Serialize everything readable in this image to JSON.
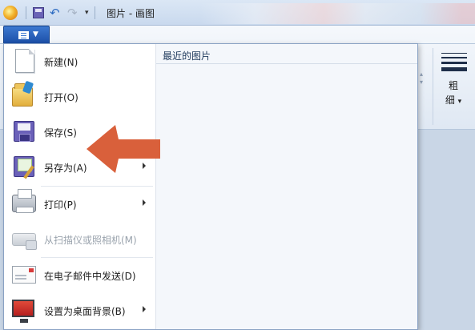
{
  "window": {
    "title": "图片 - 画图"
  },
  "quick_access": {
    "app_icon": "paint-app-icon",
    "save_icon": "save-icon",
    "undo_icon": "undo-icon",
    "redo_icon": "redo-icon",
    "more_icon": "customize-dropdown-icon"
  },
  "ribbon": {
    "size_label_line1": "粗",
    "size_label_line2": "细",
    "size_label_caret": "▾"
  },
  "app_menu": {
    "button_icon": "app-menu-icon",
    "recent_title": "最近的图片",
    "items": [
      {
        "label": "新建(N)",
        "icon": "new-file-icon",
        "enabled": true,
        "submenu": false
      },
      {
        "label": "打开(O)",
        "icon": "open-folder-icon",
        "enabled": true,
        "submenu": false
      },
      {
        "label": "保存(S)",
        "icon": "save-icon",
        "enabled": true,
        "submenu": false
      },
      {
        "label": "另存为(A)",
        "icon": "save-as-icon",
        "enabled": true,
        "submenu": true
      },
      {
        "label": "打印(P)",
        "icon": "printer-icon",
        "enabled": true,
        "submenu": true
      },
      {
        "label": "从扫描仪或照相机(M)",
        "icon": "scanner-icon",
        "enabled": false,
        "submenu": false
      },
      {
        "label": "在电子邮件中发送(D)",
        "icon": "email-icon",
        "enabled": true,
        "submenu": false
      },
      {
        "label": "设置为桌面背景(B)",
        "icon": "desktop-background-icon",
        "enabled": true,
        "submenu": true
      }
    ]
  },
  "colors": {
    "menu_button": "#2a62bd",
    "annotation_arrow": "#d9603b"
  }
}
